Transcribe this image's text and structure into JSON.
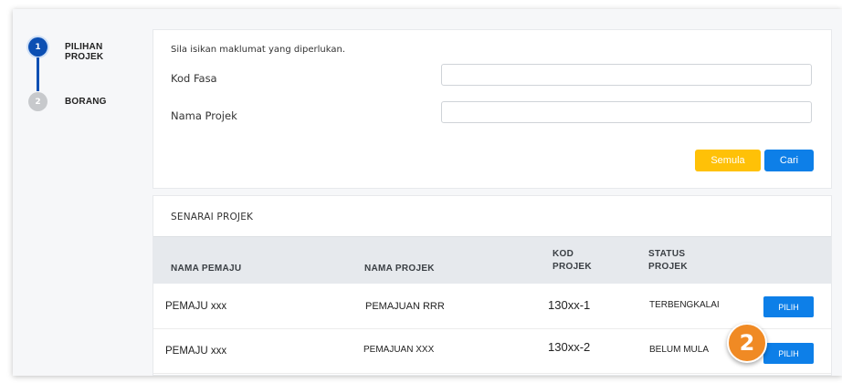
{
  "stepper": {
    "steps": [
      {
        "number": "1",
        "label": "PILIHAN PROJEK",
        "state": "active"
      },
      {
        "number": "2",
        "label": "BORANG",
        "state": "inactive"
      }
    ]
  },
  "search": {
    "intro": "Sila isikan maklumat yang diperlukan.",
    "kod_fasa_label": "Kod Fasa",
    "kod_fasa_value": "",
    "nama_projek_label": "Nama Projek",
    "nama_projek_value": "",
    "reset_label": "Semula",
    "search_label": "Cari"
  },
  "list": {
    "title": "SENARAI PROJEK",
    "headers": {
      "pemaju": "NAMA PEMAJU",
      "projek": "NAMA PROJEK",
      "kod": "KOD PROJEK",
      "status": "STATUS PROJEK"
    },
    "rows": [
      {
        "pemaju": "PEMAJU xxx",
        "projek": "PEMAJUAN RRR",
        "kod": "130xx-1",
        "status": "TERBENGKALAI",
        "action": "PILIH"
      },
      {
        "pemaju": "PEMAJU xxx",
        "projek": "PEMAJUAN XXX",
        "kod": "130xx-2",
        "status": "BELUM MULA",
        "action": "PILIH"
      }
    ]
  },
  "annotation": {
    "step_marker": "2"
  },
  "colors": {
    "primary": "#0d7fe8",
    "step_active": "#0b4fb3",
    "reset_button": "#ffc107",
    "marker": "#f08a24"
  }
}
